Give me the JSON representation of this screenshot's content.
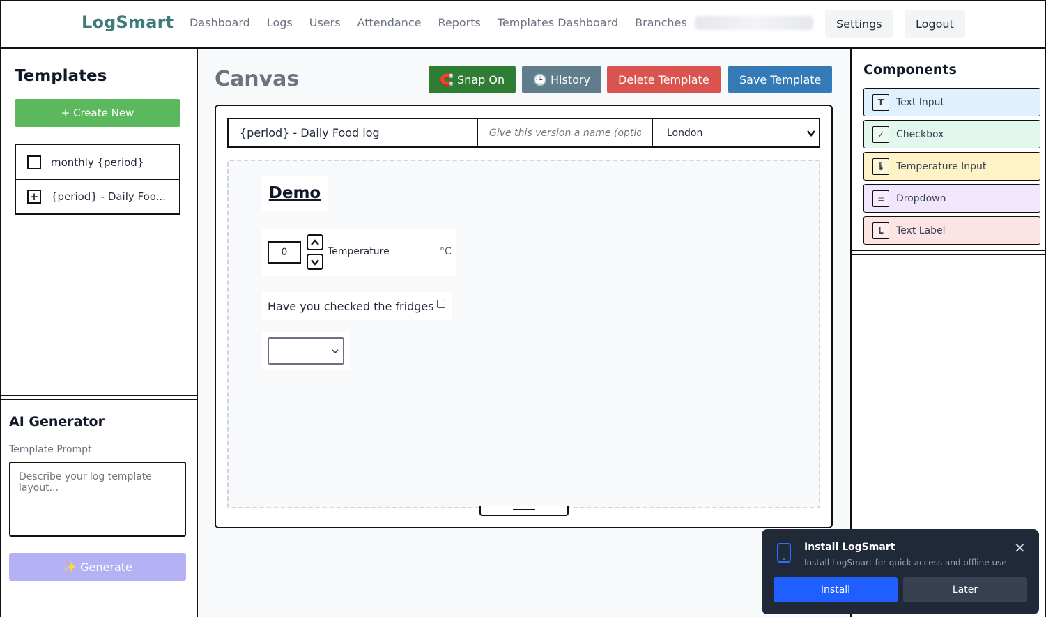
{
  "header": {
    "brand": "LogSmart",
    "nav": [
      "Dashboard",
      "Logs",
      "Users",
      "Attendance",
      "Reports",
      "Templates Dashboard",
      "Branches"
    ],
    "settings_label": "Settings",
    "logout_label": "Logout"
  },
  "templates": {
    "title": "Templates",
    "create_label": "+ Create New",
    "items": [
      {
        "label": "monthly {period}",
        "mark": ""
      },
      {
        "label": "{period} - Daily Foo...",
        "mark": "+"
      }
    ]
  },
  "ai": {
    "title": "AI Generator",
    "prompt_label": "Template Prompt",
    "prompt_placeholder": "Describe your log template layout...",
    "generate_label": "✨ Generate"
  },
  "canvas": {
    "title": "Canvas",
    "snap_label": "🧲 Snap On",
    "history_label": "🕒 History",
    "delete_label": "Delete Template",
    "save_label": "Save Template",
    "template_name": "{period} - Daily Food log",
    "version_placeholder": "Give this version a name (optional)",
    "branch_selected": "London",
    "demo_label": "Demo",
    "temp_value": "0",
    "temp_label": "Temperature",
    "temp_unit": "°C",
    "check_label": "Have you checked the fridges"
  },
  "components": {
    "title": "Components",
    "items": [
      {
        "icon": "T",
        "label": "Text Input",
        "bg": "#e0f0fd"
      },
      {
        "icon": "✓",
        "label": "Checkbox",
        "bg": "#e2f8ec"
      },
      {
        "icon": "🌡",
        "label": "Temperature Input",
        "bg": "#fef3c7"
      },
      {
        "icon": "≡",
        "label": "Dropdown",
        "bg": "#f1e6fd"
      },
      {
        "icon": "L",
        "label": "Text Label",
        "bg": "#fde4e4"
      }
    ]
  },
  "toast": {
    "title": "Install LogSmart",
    "subtitle": "Install LogSmart for quick access and offline use",
    "install_label": "Install",
    "later_label": "Later",
    "close_glyph": "✕"
  },
  "colors": {
    "brand": "#3d7a7a",
    "snap": "#2e7d32",
    "history": "#607d8b",
    "delete": "#d9534f",
    "save": "#337ab7",
    "create": "#5cb85c",
    "install": "#1f5fff",
    "later": "#374151"
  }
}
